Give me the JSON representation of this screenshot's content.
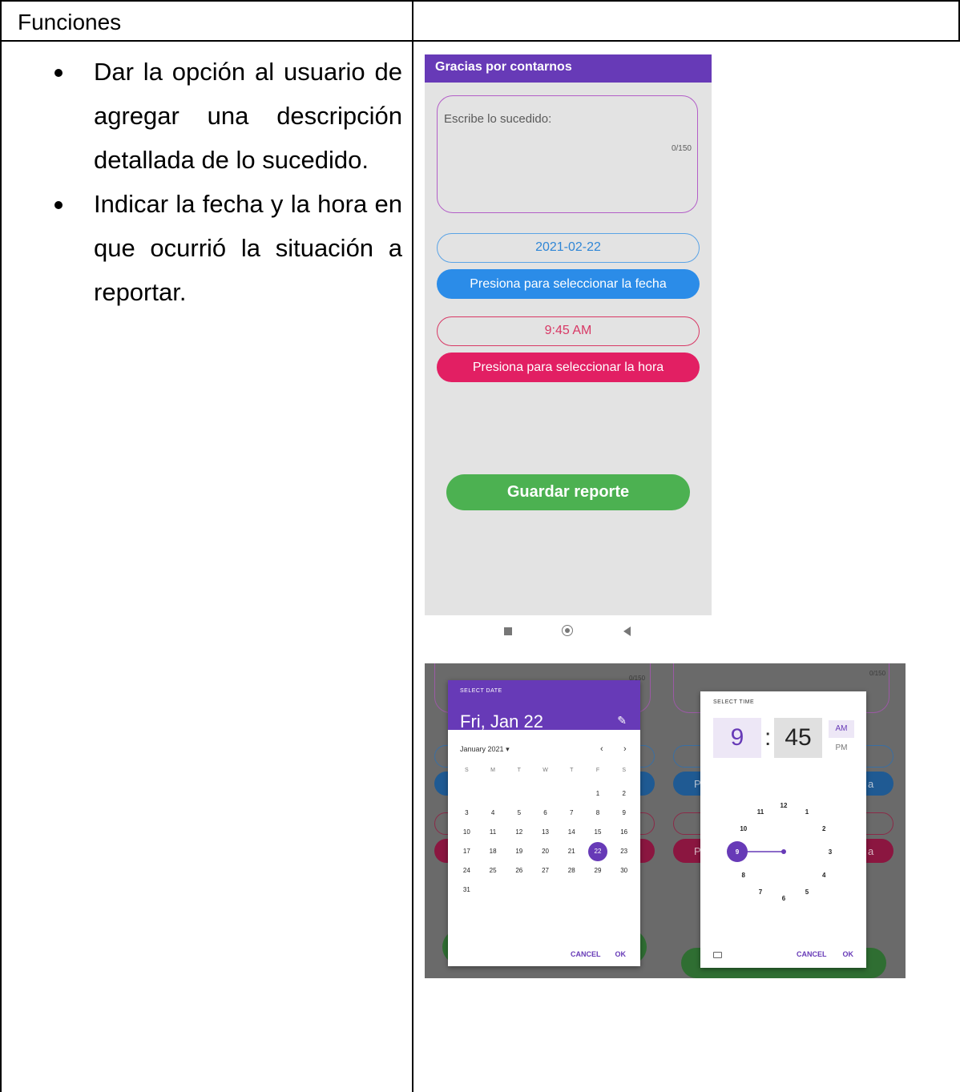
{
  "table": {
    "header_left": "Funciones",
    "bullets": [
      "Dar la opción al usuario de agregar una descripción detallada de lo sucedido.",
      "Indicar la fecha y la hora en que ocurrió la situación a reportar."
    ]
  },
  "app": {
    "appbar_title": "Gracias por contarnos",
    "description_placeholder": "Escribe lo sucedido:",
    "char_counter": "0/150",
    "date_value": "2021-02-22",
    "date_button": "Presiona para seleccionar la fecha",
    "time_value": "9:45 AM",
    "time_button": "Presiona para seleccionar la hora",
    "save_button": "Guardar reporte",
    "colors": {
      "primary": "#673ab7",
      "date_blue": "#2b8ce8",
      "time_pink": "#e21f63",
      "save_green": "#4cb151"
    }
  },
  "date_picker": {
    "label": "SELECT DATE",
    "selected_date": "Fri, Jan 22",
    "month_label": "January 2021",
    "weekdays": [
      "S",
      "M",
      "T",
      "W",
      "T",
      "F",
      "S"
    ],
    "weeks": [
      [
        "",
        "",
        "",
        "",
        "",
        "1",
        "2"
      ],
      [
        "3",
        "4",
        "5",
        "6",
        "7",
        "8",
        "9"
      ],
      [
        "10",
        "11",
        "12",
        "13",
        "14",
        "15",
        "16"
      ],
      [
        "17",
        "18",
        "19",
        "20",
        "21",
        "22",
        "23"
      ],
      [
        "24",
        "25",
        "26",
        "27",
        "28",
        "29",
        "30"
      ],
      [
        "31",
        "",
        "",
        "",
        "",
        "",
        ""
      ]
    ],
    "selected_day": "22",
    "cancel": "CANCEL",
    "ok": "OK",
    "bg_counter": "0/150"
  },
  "time_picker": {
    "label": "SELECT TIME",
    "hour": "9",
    "separator": ":",
    "minute": "45",
    "am": "AM",
    "pm": "PM",
    "clock_numbers": [
      "12",
      "1",
      "2",
      "3",
      "4",
      "5",
      "6",
      "7",
      "8",
      "9",
      "10",
      "11"
    ],
    "selected_hour": "9",
    "cancel": "CANCEL",
    "ok": "OK",
    "bg_counter": "0/150",
    "bg_button_left": "P",
    "bg_button_right": "a"
  }
}
